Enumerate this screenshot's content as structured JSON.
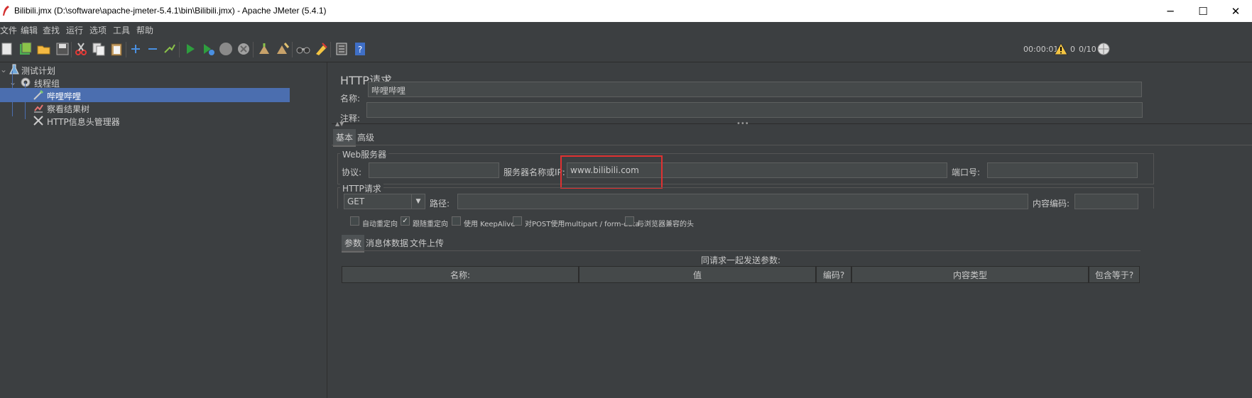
{
  "window": {
    "title": "Bilibili.jmx (D:\\software\\apache-jmeter-5.4.1\\bin\\Bilibili.jmx) - Apache JMeter (5.4.1)",
    "minimize": "─",
    "maximize": "☐",
    "close": "✕"
  },
  "menu": [
    "文件",
    "编辑",
    "查找",
    "运行",
    "选项",
    "工具",
    "帮助"
  ],
  "toolbar": {
    "timer": "00:00:01",
    "warn_count": "0",
    "threads": "0/10"
  },
  "tree": {
    "items": [
      {
        "label": "测试计划",
        "icon": "flask-icon"
      },
      {
        "label": "线程组",
        "icon": "gear-icon"
      },
      {
        "label": "哔哩哔哩",
        "icon": "pipette-icon"
      },
      {
        "label": "察看结果树",
        "icon": "chart-icon"
      },
      {
        "label": "HTTP信息头管理器",
        "icon": "wrench-icon"
      }
    ]
  },
  "panel": {
    "title": "HTTP请求",
    "name_label": "名称:",
    "name_value": "哔哩哔哩",
    "comment_label": "注释:",
    "comment_value": "",
    "tabs": [
      "基本",
      "高级"
    ],
    "web_server": {
      "legend": "Web服务器",
      "protocol_label": "协议:",
      "protocol_value": "",
      "server_label": "服务器名称或IP:",
      "server_value": "www.bilibili.com",
      "port_label": "端口号:",
      "port_value": ""
    },
    "http_request": {
      "legend": "HTTP请求",
      "method": "GET",
      "path_label": "路径:",
      "path_value": "",
      "encoding_label": "内容编码:",
      "encoding_value": ""
    },
    "checkboxes": [
      {
        "label": "自动重定向",
        "checked": false
      },
      {
        "label": "跟随重定向",
        "checked": true
      },
      {
        "label": "使用 KeepAlive",
        "checked": false
      },
      {
        "label": "对POST使用multipart / form-data",
        "checked": false
      },
      {
        "label": "与浏览器兼容的头",
        "checked": false
      }
    ],
    "subtabs": [
      "参数",
      "消息体数据",
      "文件上传"
    ],
    "params_caption": "同请求一起发送参数:",
    "columns": [
      "名称:",
      "值",
      "编码?",
      "内容类型",
      "包含等于?"
    ]
  }
}
